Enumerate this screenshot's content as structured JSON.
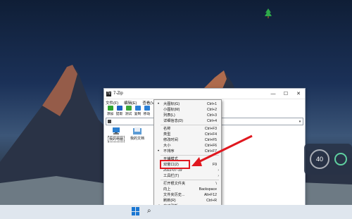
{
  "window": {
    "title": "7-Zip",
    "controls": {
      "minimize": "—",
      "maximize": "☐",
      "close": "✕"
    }
  },
  "menubar": [
    "文件(F)",
    "编辑(E)",
    "查看(V)",
    "收"
  ],
  "toolbar": [
    {
      "label": "添加",
      "color": "#2fa52f"
    },
    {
      "label": "提取",
      "color": "#1d62c4"
    },
    {
      "label": "测试",
      "color": "#3aa83a"
    },
    {
      "label": "复制",
      "color": "#2a7fd6"
    },
    {
      "label": "移动",
      "color": "#2a7fd6"
    }
  ],
  "address": {
    "value": ""
  },
  "files": [
    {
      "name": "我的电脑",
      "selected": true
    },
    {
      "name": "我的文档",
      "selected": false
    }
  ],
  "context_menu": [
    {
      "label": "大图标(G)",
      "shortcut": "Ctrl+1",
      "radio": true
    },
    {
      "label": "小图标(M)",
      "shortcut": "Ctrl+2"
    },
    {
      "label": "列表(L)",
      "shortcut": "Ctrl+3"
    },
    {
      "label": "详细信息(D)",
      "shortcut": "Ctrl+4"
    },
    {
      "sep": true
    },
    {
      "label": "名称",
      "shortcut": "Ctrl+F3"
    },
    {
      "label": "类型",
      "shortcut": "Ctrl+F4"
    },
    {
      "label": "修改时间",
      "shortcut": "Ctrl+F5"
    },
    {
      "label": "大小",
      "shortcut": "Ctrl+F6"
    },
    {
      "label": "不排序",
      "shortcut": "Ctrl+F7",
      "radio": true
    },
    {
      "sep": true
    },
    {
      "label": "平铺模式",
      "shortcut": ""
    },
    {
      "label": "双窗口(2)",
      "shortcut": "F9"
    },
    {
      "label": "2022-07-19",
      "shortcut": "",
      "submenu": true
    },
    {
      "label": "工具栏(T)",
      "shortcut": "",
      "submenu": true
    },
    {
      "sep": true
    },
    {
      "label": "打开根文件夹",
      "shortcut": "\\"
    },
    {
      "label": "向上",
      "shortcut": "Backspace"
    },
    {
      "label": "文件夹历史...",
      "shortcut": "Alt+F12"
    },
    {
      "label": "刷新(R)",
      "shortcut": "Ctrl+R"
    },
    {
      "label": "自动刷新",
      "shortcut": "",
      "check": true
    }
  ],
  "side_widget": {
    "value": "40"
  },
  "colors": {
    "highlight": "#e0181f",
    "accent": "#1976d2"
  }
}
